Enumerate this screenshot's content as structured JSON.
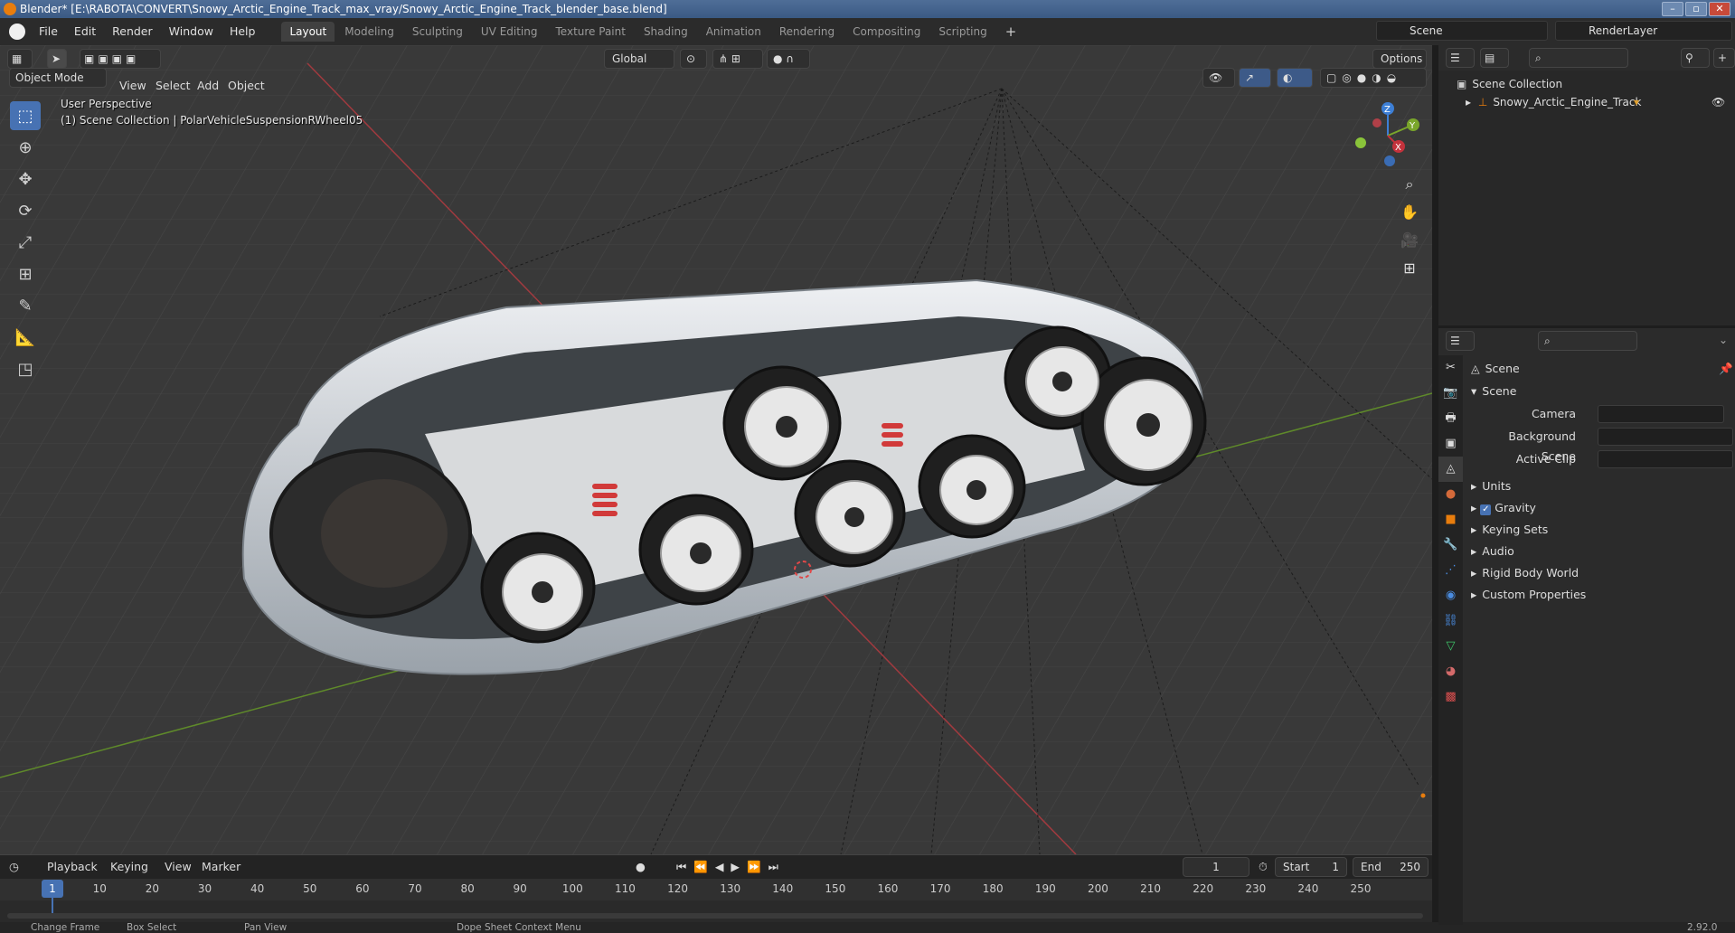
{
  "titlebar": {
    "text": "Blender* [E:\\RABOTA\\CONVERT\\Snowy_Arctic_Engine_Track_max_vray/Snowy_Arctic_Engine_Track_blender_base.blend]"
  },
  "menus": [
    "File",
    "Edit",
    "Render",
    "Window",
    "Help"
  ],
  "workspaces": [
    "Layout",
    "Modeling",
    "Sculpting",
    "UV Editing",
    "Texture Paint",
    "Shading",
    "Animation",
    "Rendering",
    "Compositing",
    "Scripting"
  ],
  "scene_name": "Scene",
  "render_layer": "RenderLayer",
  "viewport": {
    "mode": "Object Mode",
    "menu": [
      "View",
      "Select",
      "Add",
      "Object"
    ],
    "orientation": "Global",
    "options_label": "Options",
    "perspective_label": "User Perspective",
    "collection_label": "(1) Scene Collection | PolarVehicleSuspensionRWheel05",
    "gizmo_axes": [
      "X",
      "Y",
      "Z"
    ]
  },
  "timeline": {
    "menu": [
      "Playback",
      "Keying",
      "View",
      "Marker"
    ],
    "current_frame": "1",
    "start_label": "Start",
    "start": "1",
    "end_label": "End",
    "end": "250",
    "ticks": [
      "1",
      "10",
      "20",
      "30",
      "40",
      "50",
      "60",
      "70",
      "80",
      "90",
      "100",
      "110",
      "120",
      "130",
      "140",
      "150",
      "160",
      "170",
      "180",
      "190",
      "200",
      "210",
      "220",
      "230",
      "240",
      "250"
    ]
  },
  "statusbar": {
    "items": [
      "Change Frame",
      "Box Select",
      "Pan View",
      "Dope Sheet Context Menu"
    ],
    "version": "2.92.0"
  },
  "outliner": {
    "root": "Scene Collection",
    "items": [
      "Snowy_Arctic_Engine_Track"
    ]
  },
  "properties": {
    "header": "Scene",
    "panel": "Scene",
    "fields": {
      "camera": "Camera",
      "background_scene": "Background Scene",
      "active_clip": "Active Clip"
    },
    "sections": [
      "Units",
      "Gravity",
      "Keying Sets",
      "Audio",
      "Rigid Body World",
      "Custom Properties"
    ]
  },
  "colors": {
    "accent": "#4772b3",
    "x_axis": "#c4323c",
    "y_axis": "#7aa62b",
    "z_axis": "#3d7fd6",
    "orange": "#e87d0d"
  }
}
